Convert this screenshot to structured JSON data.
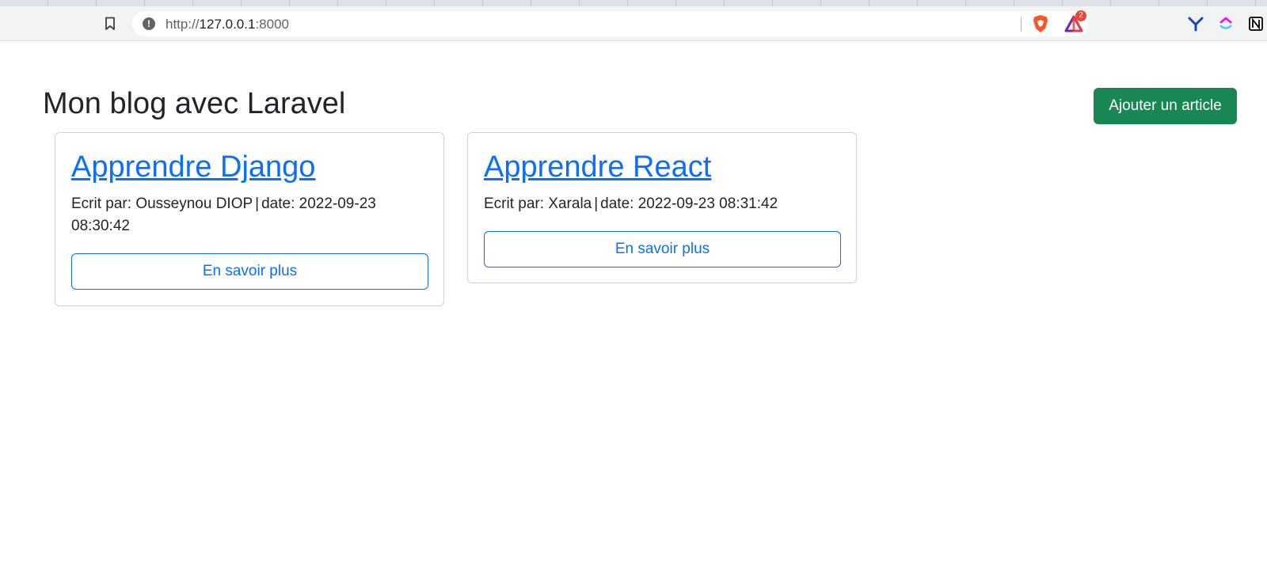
{
  "browser": {
    "url_scheme": "http://",
    "url_host": "127.0.0.1",
    "url_port": ":8000",
    "extensions": [
      {
        "name": "brave-shield-icon",
        "color": "#fb542b"
      },
      {
        "name": "brave-rewards-icon",
        "color": "#6a2aa5",
        "badge": "2"
      },
      {
        "name": "yoroi-icon",
        "color": "#1a44b7"
      },
      {
        "name": "clickup-icon",
        "color": "#7b68ee"
      },
      {
        "name": "notion-icon",
        "color": "#000000"
      }
    ]
  },
  "header": {
    "title": "Mon blog avec Laravel",
    "add_button_label": "Ajouter un article"
  },
  "articles": [
    {
      "title": "Apprendre Django",
      "author_prefix": "Ecrit par: ",
      "author": "Ousseynou DIOP",
      "date_prefix": "date: ",
      "date": "2022-09-23 08:30:42",
      "button_label": "En savoir plus"
    },
    {
      "title": "Apprendre React",
      "author_prefix": "Ecrit par: ",
      "author": "Xarala",
      "date_prefix": "date: ",
      "date": "2022-09-23 08:31:42",
      "button_label": "En savoir plus"
    }
  ],
  "colors": {
    "primary": "#0d6efd",
    "success": "#198754",
    "text": "#212529"
  }
}
